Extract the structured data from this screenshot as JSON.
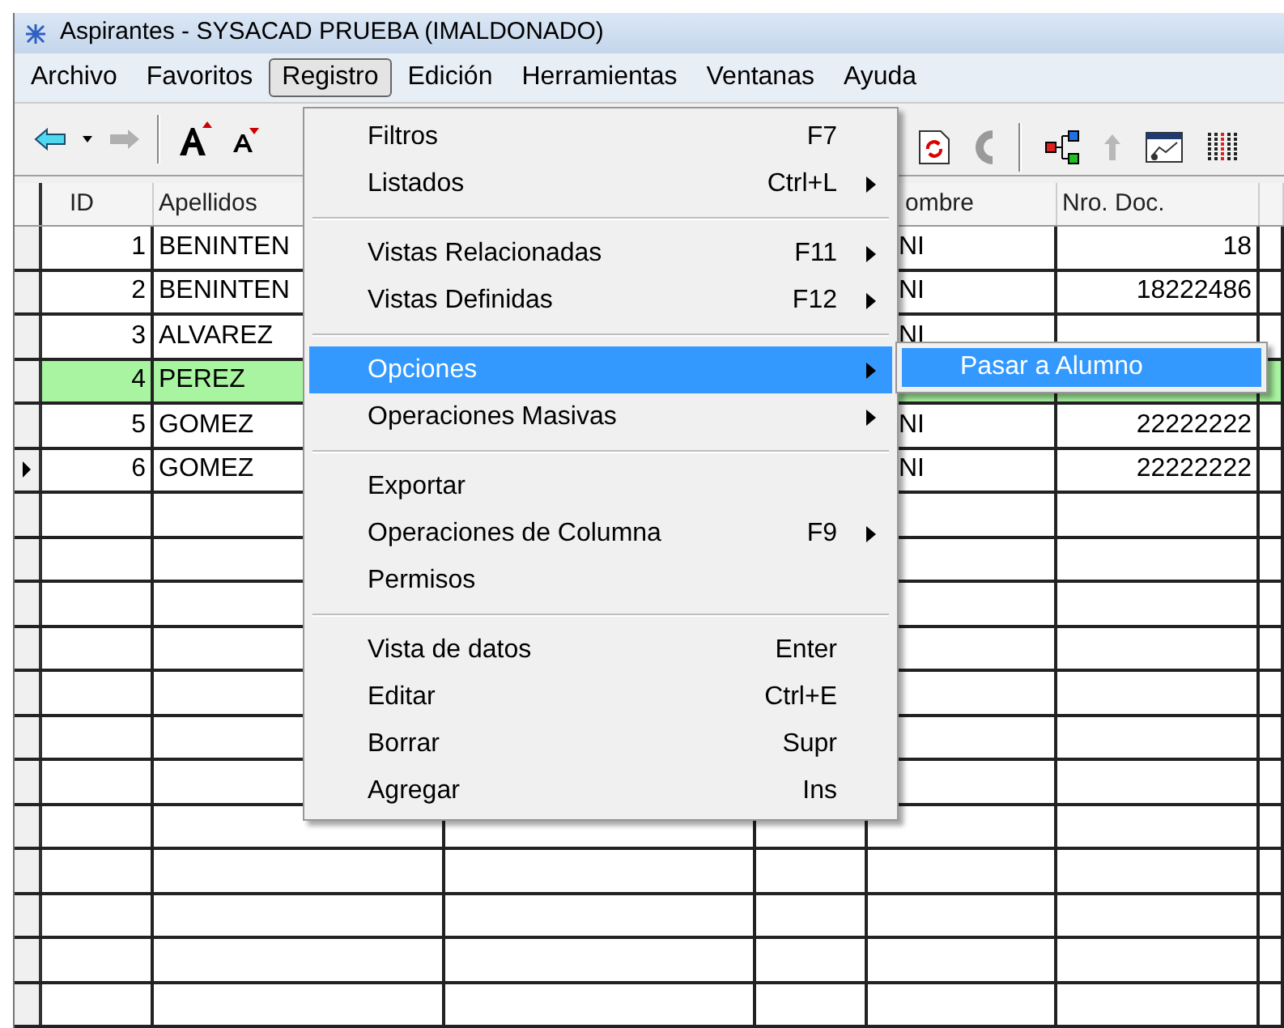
{
  "window": {
    "title": "Aspirantes - SYSACAD PRUEBA (IMALDONADO)"
  },
  "menubar": [
    {
      "label": "Archivo",
      "selected": false
    },
    {
      "label": "Favoritos",
      "selected": false
    },
    {
      "label": "Registro",
      "selected": true
    },
    {
      "label": "Edición",
      "selected": false
    },
    {
      "label": "Herramientas",
      "selected": false
    },
    {
      "label": "Ventanas",
      "selected": false
    },
    {
      "label": "Ayuda",
      "selected": false
    }
  ],
  "table": {
    "columns": [
      "ID",
      "Apellidos",
      "",
      "",
      "ombre",
      "Nro. Doc.",
      ""
    ],
    "rows": [
      {
        "cells": [
          "1",
          "BENINTEN",
          "",
          "",
          "NI",
          "18",
          ""
        ],
        "highlighted": false,
        "current": false
      },
      {
        "cells": [
          "2",
          "BENINTEN",
          "",
          "",
          "NI",
          "18222486",
          ""
        ],
        "highlighted": false,
        "current": false
      },
      {
        "cells": [
          "3",
          "ALVAREZ",
          "",
          "",
          "NI",
          "",
          ""
        ],
        "highlighted": false,
        "current": false
      },
      {
        "cells": [
          "4",
          "PEREZ",
          "",
          "",
          "",
          "",
          ""
        ],
        "highlighted": true,
        "current": false
      },
      {
        "cells": [
          "5",
          "GOMEZ",
          "",
          "",
          "NI",
          "22222222",
          ""
        ],
        "highlighted": false,
        "current": false
      },
      {
        "cells": [
          "6",
          "GOMEZ",
          "",
          "",
          "NI",
          "22222222",
          ""
        ],
        "highlighted": false,
        "current": true
      }
    ]
  },
  "menu": {
    "items": [
      {
        "kind": "item",
        "label": "Filtros",
        "shortcut": "F7",
        "submenu": false,
        "selected": false
      },
      {
        "kind": "item",
        "label": "Listados",
        "shortcut": "Ctrl+L",
        "submenu": true,
        "selected": false
      },
      {
        "kind": "separator"
      },
      {
        "kind": "item",
        "label": "Vistas Relacionadas",
        "shortcut": "F11",
        "submenu": true,
        "selected": false
      },
      {
        "kind": "item",
        "label": "Vistas Definidas",
        "shortcut": "F12",
        "submenu": true,
        "selected": false
      },
      {
        "kind": "separator"
      },
      {
        "kind": "item",
        "label": "Opciones",
        "submenu": true,
        "selected": true
      },
      {
        "kind": "item",
        "label": "Operaciones Masivas",
        "submenu": true,
        "selected": false
      },
      {
        "kind": "separator"
      },
      {
        "kind": "item",
        "label": "Exportar",
        "submenu": false,
        "selected": false
      },
      {
        "kind": "item",
        "label": "Operaciones de Columna",
        "shortcut": "F9",
        "submenu": true,
        "selected": false
      },
      {
        "kind": "item",
        "label": "Permisos",
        "submenu": false,
        "selected": false
      },
      {
        "kind": "separator"
      },
      {
        "kind": "item",
        "label": "Vista de datos",
        "shortcut": "Enter",
        "submenu": false,
        "selected": false
      },
      {
        "kind": "item",
        "label": "Editar",
        "shortcut": "Ctrl+E",
        "submenu": false,
        "selected": false
      },
      {
        "kind": "item",
        "label": "Borrar",
        "shortcut": "Supr",
        "submenu": false,
        "selected": false
      },
      {
        "kind": "item",
        "label": "Agregar",
        "shortcut": "Ins",
        "submenu": false,
        "selected": false
      }
    ]
  },
  "submenu": {
    "items": [
      {
        "label": "Pasar a Alumno",
        "selected": true
      }
    ]
  }
}
